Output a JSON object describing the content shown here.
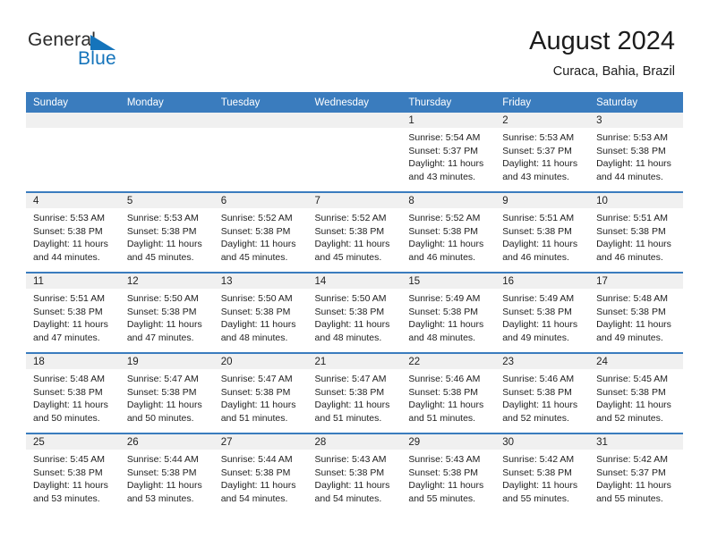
{
  "brand": {
    "name_part1": "General",
    "name_part2": "Blue",
    "triangle_color": "#1574bb"
  },
  "header": {
    "title": "August 2024",
    "subtitle": "Curaca, Bahia, Brazil"
  },
  "theme": {
    "header_row_bg": "#3a7cbe",
    "daynum_band_bg": "#f0f0f0",
    "text_color": "#222222"
  },
  "calendar": {
    "weekday_headers": [
      "Sunday",
      "Monday",
      "Tuesday",
      "Wednesday",
      "Thursday",
      "Friday",
      "Saturday"
    ],
    "weeks": [
      [
        {
          "day": "",
          "lines": []
        },
        {
          "day": "",
          "lines": []
        },
        {
          "day": "",
          "lines": []
        },
        {
          "day": "",
          "lines": []
        },
        {
          "day": "1",
          "lines": [
            "Sunrise: 5:54 AM",
            "Sunset: 5:37 PM",
            "Daylight: 11 hours",
            "and 43 minutes."
          ]
        },
        {
          "day": "2",
          "lines": [
            "Sunrise: 5:53 AM",
            "Sunset: 5:37 PM",
            "Daylight: 11 hours",
            "and 43 minutes."
          ]
        },
        {
          "day": "3",
          "lines": [
            "Sunrise: 5:53 AM",
            "Sunset: 5:38 PM",
            "Daylight: 11 hours",
            "and 44 minutes."
          ]
        }
      ],
      [
        {
          "day": "4",
          "lines": [
            "Sunrise: 5:53 AM",
            "Sunset: 5:38 PM",
            "Daylight: 11 hours",
            "and 44 minutes."
          ]
        },
        {
          "day": "5",
          "lines": [
            "Sunrise: 5:53 AM",
            "Sunset: 5:38 PM",
            "Daylight: 11 hours",
            "and 45 minutes."
          ]
        },
        {
          "day": "6",
          "lines": [
            "Sunrise: 5:52 AM",
            "Sunset: 5:38 PM",
            "Daylight: 11 hours",
            "and 45 minutes."
          ]
        },
        {
          "day": "7",
          "lines": [
            "Sunrise: 5:52 AM",
            "Sunset: 5:38 PM",
            "Daylight: 11 hours",
            "and 45 minutes."
          ]
        },
        {
          "day": "8",
          "lines": [
            "Sunrise: 5:52 AM",
            "Sunset: 5:38 PM",
            "Daylight: 11 hours",
            "and 46 minutes."
          ]
        },
        {
          "day": "9",
          "lines": [
            "Sunrise: 5:51 AM",
            "Sunset: 5:38 PM",
            "Daylight: 11 hours",
            "and 46 minutes."
          ]
        },
        {
          "day": "10",
          "lines": [
            "Sunrise: 5:51 AM",
            "Sunset: 5:38 PM",
            "Daylight: 11 hours",
            "and 46 minutes."
          ]
        }
      ],
      [
        {
          "day": "11",
          "lines": [
            "Sunrise: 5:51 AM",
            "Sunset: 5:38 PM",
            "Daylight: 11 hours",
            "and 47 minutes."
          ]
        },
        {
          "day": "12",
          "lines": [
            "Sunrise: 5:50 AM",
            "Sunset: 5:38 PM",
            "Daylight: 11 hours",
            "and 47 minutes."
          ]
        },
        {
          "day": "13",
          "lines": [
            "Sunrise: 5:50 AM",
            "Sunset: 5:38 PM",
            "Daylight: 11 hours",
            "and 48 minutes."
          ]
        },
        {
          "day": "14",
          "lines": [
            "Sunrise: 5:50 AM",
            "Sunset: 5:38 PM",
            "Daylight: 11 hours",
            "and 48 minutes."
          ]
        },
        {
          "day": "15",
          "lines": [
            "Sunrise: 5:49 AM",
            "Sunset: 5:38 PM",
            "Daylight: 11 hours",
            "and 48 minutes."
          ]
        },
        {
          "day": "16",
          "lines": [
            "Sunrise: 5:49 AM",
            "Sunset: 5:38 PM",
            "Daylight: 11 hours",
            "and 49 minutes."
          ]
        },
        {
          "day": "17",
          "lines": [
            "Sunrise: 5:48 AM",
            "Sunset: 5:38 PM",
            "Daylight: 11 hours",
            "and 49 minutes."
          ]
        }
      ],
      [
        {
          "day": "18",
          "lines": [
            "Sunrise: 5:48 AM",
            "Sunset: 5:38 PM",
            "Daylight: 11 hours",
            "and 50 minutes."
          ]
        },
        {
          "day": "19",
          "lines": [
            "Sunrise: 5:47 AM",
            "Sunset: 5:38 PM",
            "Daylight: 11 hours",
            "and 50 minutes."
          ]
        },
        {
          "day": "20",
          "lines": [
            "Sunrise: 5:47 AM",
            "Sunset: 5:38 PM",
            "Daylight: 11 hours",
            "and 51 minutes."
          ]
        },
        {
          "day": "21",
          "lines": [
            "Sunrise: 5:47 AM",
            "Sunset: 5:38 PM",
            "Daylight: 11 hours",
            "and 51 minutes."
          ]
        },
        {
          "day": "22",
          "lines": [
            "Sunrise: 5:46 AM",
            "Sunset: 5:38 PM",
            "Daylight: 11 hours",
            "and 51 minutes."
          ]
        },
        {
          "day": "23",
          "lines": [
            "Sunrise: 5:46 AM",
            "Sunset: 5:38 PM",
            "Daylight: 11 hours",
            "and 52 minutes."
          ]
        },
        {
          "day": "24",
          "lines": [
            "Sunrise: 5:45 AM",
            "Sunset: 5:38 PM",
            "Daylight: 11 hours",
            "and 52 minutes."
          ]
        }
      ],
      [
        {
          "day": "25",
          "lines": [
            "Sunrise: 5:45 AM",
            "Sunset: 5:38 PM",
            "Daylight: 11 hours",
            "and 53 minutes."
          ]
        },
        {
          "day": "26",
          "lines": [
            "Sunrise: 5:44 AM",
            "Sunset: 5:38 PM",
            "Daylight: 11 hours",
            "and 53 minutes."
          ]
        },
        {
          "day": "27",
          "lines": [
            "Sunrise: 5:44 AM",
            "Sunset: 5:38 PM",
            "Daylight: 11 hours",
            "and 54 minutes."
          ]
        },
        {
          "day": "28",
          "lines": [
            "Sunrise: 5:43 AM",
            "Sunset: 5:38 PM",
            "Daylight: 11 hours",
            "and 54 minutes."
          ]
        },
        {
          "day": "29",
          "lines": [
            "Sunrise: 5:43 AM",
            "Sunset: 5:38 PM",
            "Daylight: 11 hours",
            "and 55 minutes."
          ]
        },
        {
          "day": "30",
          "lines": [
            "Sunrise: 5:42 AM",
            "Sunset: 5:38 PM",
            "Daylight: 11 hours",
            "and 55 minutes."
          ]
        },
        {
          "day": "31",
          "lines": [
            "Sunrise: 5:42 AM",
            "Sunset: 5:37 PM",
            "Daylight: 11 hours",
            "and 55 minutes."
          ]
        }
      ]
    ]
  }
}
